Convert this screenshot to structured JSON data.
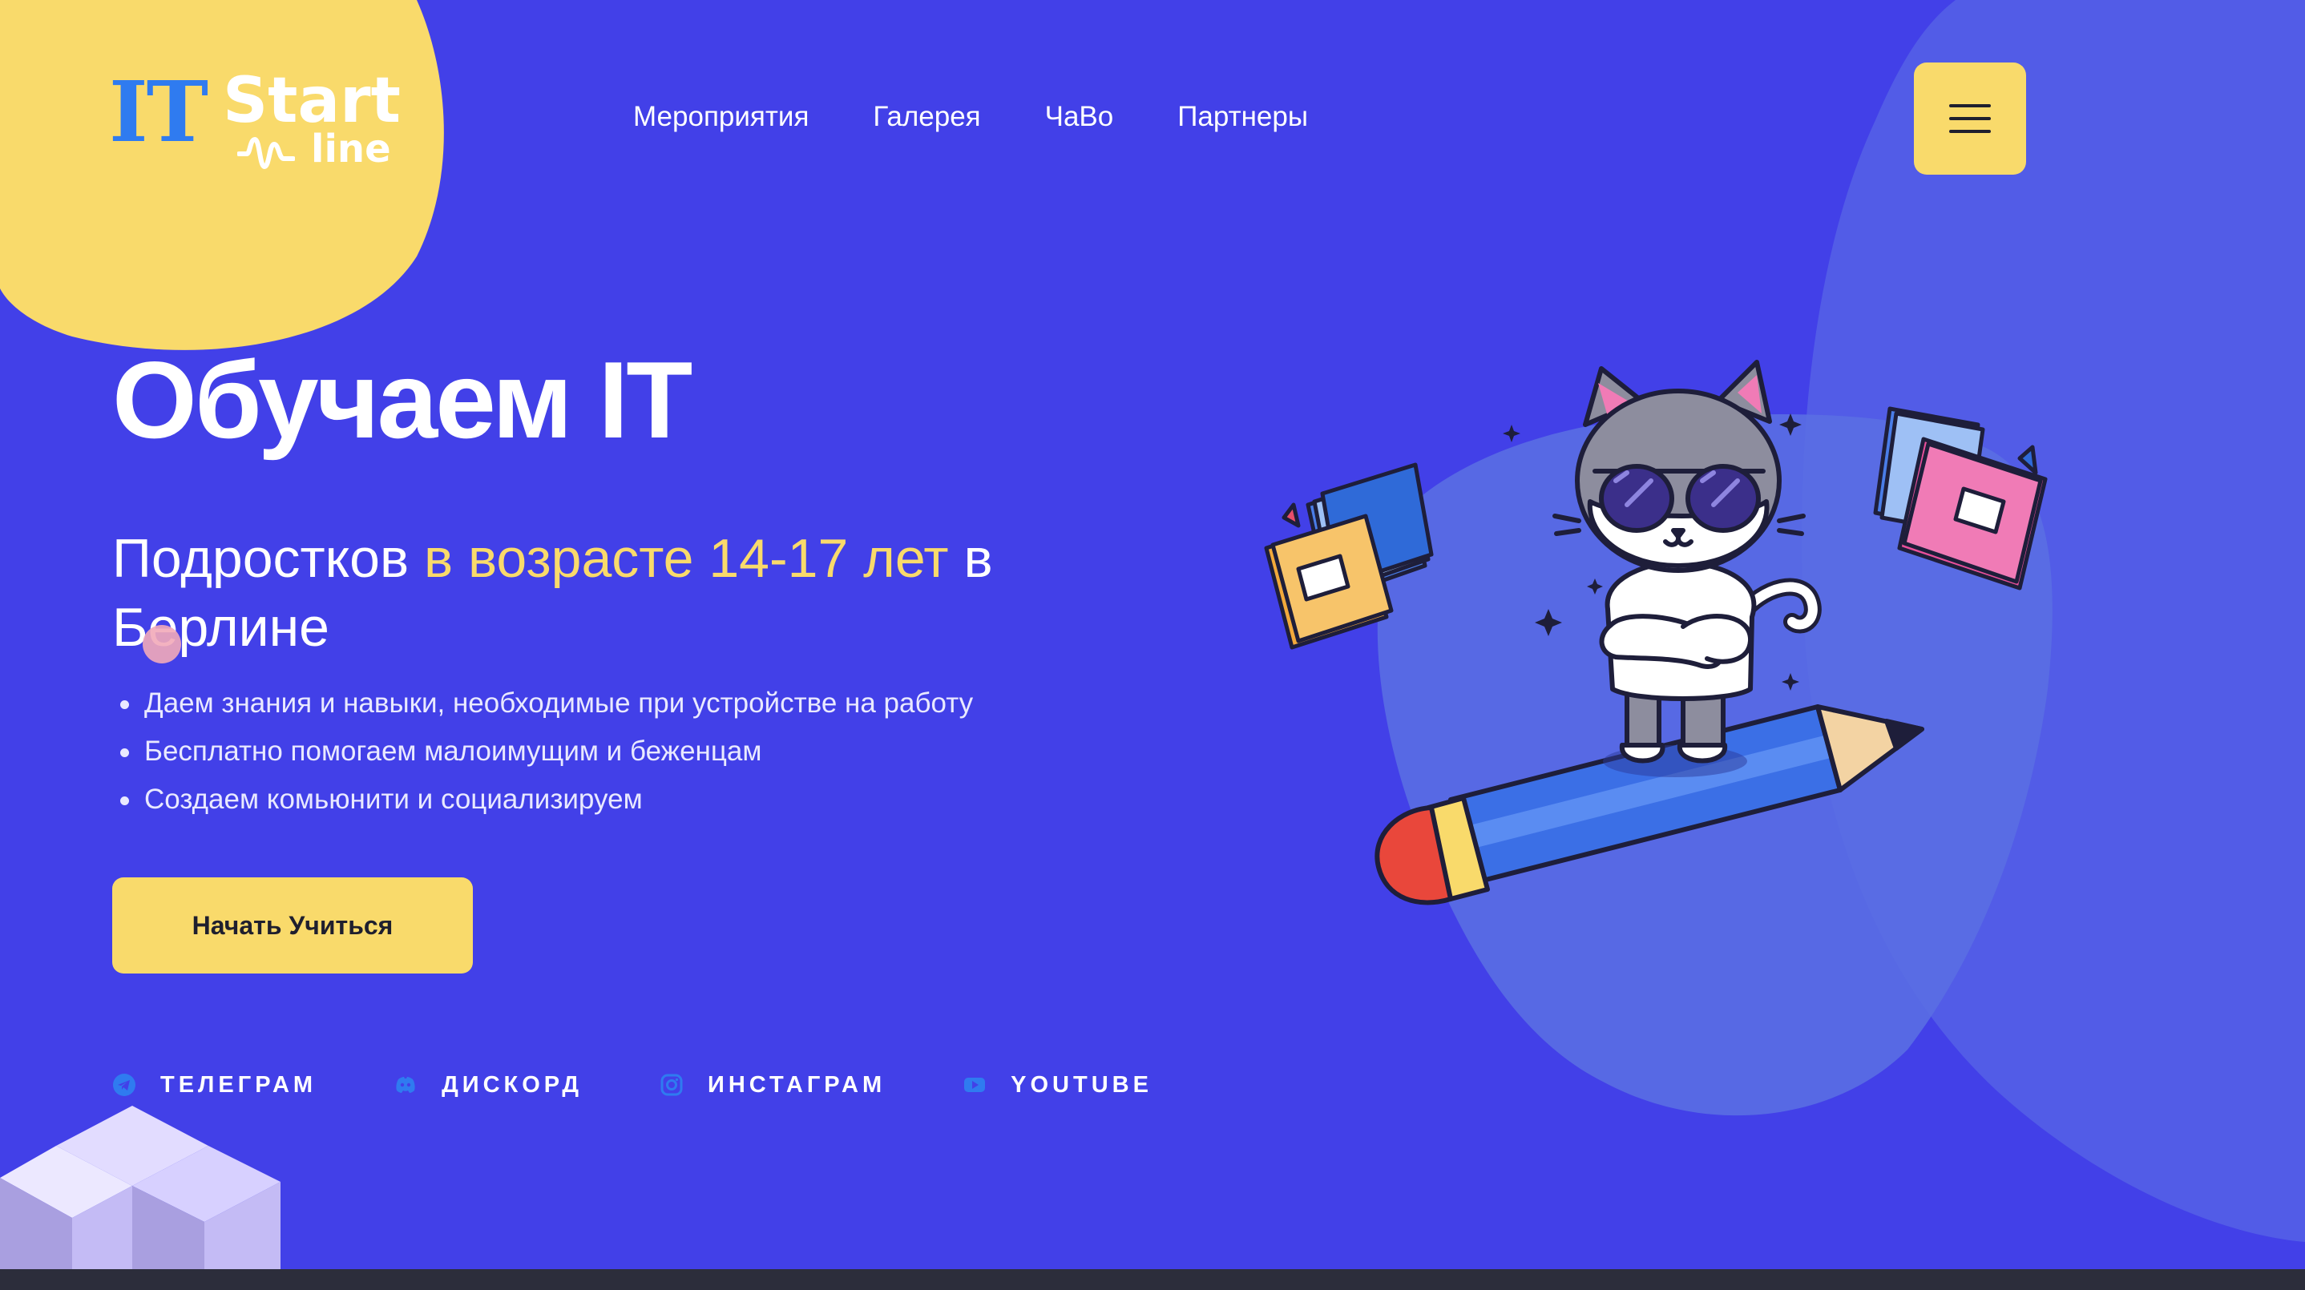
{
  "logo": {
    "it": "IT",
    "start": "Start",
    "line": "line"
  },
  "nav": {
    "items": [
      {
        "label": "Мероприятия"
      },
      {
        "label": "Галерея"
      },
      {
        "label": "ЧаВо"
      },
      {
        "label": "Партнеры"
      }
    ],
    "menu_icon": "hamburger-menu-icon"
  },
  "hero": {
    "title": "Обучаем IT",
    "subtitle": {
      "part1": "Подростков ",
      "highlight": "в возрасте 14-17 лет",
      "part2": " в Берлине"
    },
    "bullets": [
      "Даем знания и навыки, необходимые при устройстве на работу",
      "Бесплатно помогаем малоимущим и беженцам",
      "Создаем комьюнити и социализируем"
    ],
    "cta_label": "Начать Учиться"
  },
  "socials": [
    {
      "label": "ТЕЛЕГРАМ",
      "icon": "telegram-icon"
    },
    {
      "label": "ДИСКОРД",
      "icon": "discord-icon"
    },
    {
      "label": "ИНСТАГРАМ",
      "icon": "instagram-icon"
    },
    {
      "label": "YOUTUBE",
      "icon": "youtube-icon"
    }
  ],
  "colors": {
    "background": "#4240e8",
    "accent_yellow": "#f9da6b",
    "icon_blue": "#2f7bf0",
    "blob_light": "#5e68e6",
    "footer_bar": "#2c2d3b"
  }
}
